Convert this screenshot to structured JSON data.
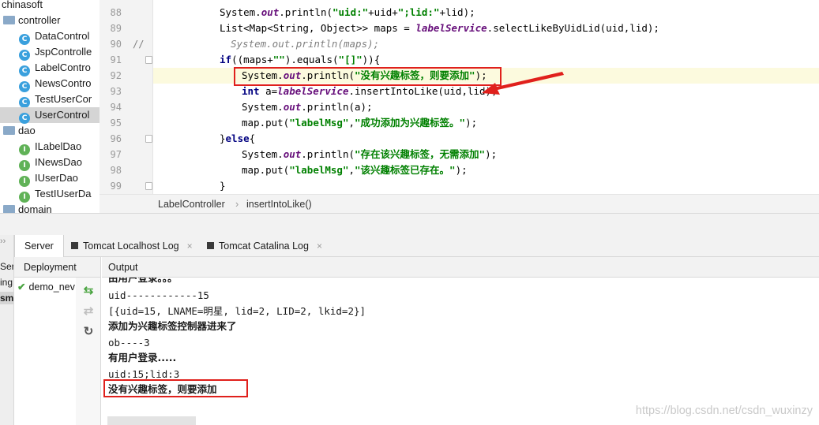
{
  "project_tree": {
    "root": "chinasoft",
    "folders": [
      "controller",
      "dao",
      "domain"
    ],
    "controller_items": [
      "DataControl",
      "JspControlle",
      "LabelContro",
      "NewsContro",
      "TestUserCor",
      "UserControl"
    ],
    "dao_items": [
      "ILabelDao",
      "INewsDao",
      "IUserDao",
      "TestIUserDa"
    ],
    "class_badge": "C",
    "interface_badge": "I"
  },
  "editor": {
    "line_numbers": [
      "88",
      "89",
      "90",
      "91",
      "92",
      "93",
      "94",
      "95",
      "96",
      "97",
      "98",
      "99"
    ],
    "comment_marker": "//",
    "lines": [
      [
        "",
        "",
        "",
        "System.",
        "out",
        ".println(",
        "\"uid:\"",
        "+uid+",
        "\";lid:\"",
        "+lid);"
      ],
      [
        "",
        "",
        "",
        "List<Map<String, Object>> maps = ",
        "labelService",
        ".selectLikeByUidLid(uid,lid);",
        "",
        "",
        "",
        ""
      ],
      [
        "",
        "",
        "",
        "",
        "",
        "",
        "",
        "",
        "",
        ""
      ]
    ],
    "code": {
      "l88_a": "System.",
      "l88_out": "out",
      "l88_b": ".println(",
      "l88_s1": "\"uid:\"",
      "l88_c": "+uid+",
      "l88_s2": "\";lid:\"",
      "l88_d": "+lid);",
      "l89_a": "List<Map<String, Object>> maps = ",
      "l89_svc": "labelService",
      "l89_b": ".selectLikeByUidLid(uid,lid);",
      "l90_cmt": "System.out.println(maps);",
      "l91_if": "if",
      "l91_a": "((maps+",
      "l91_s1": "\"\"",
      "l91_b": ").equals(",
      "l91_s2": "\"[]\"",
      "l91_c": ")){",
      "l92_a": "System.",
      "l92_out": "out",
      "l92_b": ".println(",
      "l92_s": "\"没有兴趣标签，则要添加\"",
      "l92_c": ");",
      "l93_int": "int",
      "l93_a": " a=",
      "l93_svc": "labelService",
      "l93_b": ".insertIntoLike(uid,lid);",
      "l94_a": "System.",
      "l94_out": "out",
      "l94_b": ".println(a);",
      "l95_a": "map.put(",
      "l95_s1": "\"labelMsg\"",
      "l95_b": ",",
      "l95_s2": "\"成功添加为兴趣标签。\"",
      "l95_c": ");",
      "l96_a": "}",
      "l96_else": "else",
      "l96_b": "{",
      "l97_a": "System.",
      "l97_out": "out",
      "l97_b": ".println(",
      "l97_s": "\"存在该兴趣标签，无需添加\"",
      "l97_c": ");",
      "l98_a": "map.put(",
      "l98_s1": "\"labelMsg\"",
      "l98_b": ",",
      "l98_s2": "\"该兴趣标签已存在。\"",
      "l98_c": ");",
      "l99_a": "}"
    }
  },
  "breadcrumb": {
    "class_name": "LabelController",
    "separator": "›",
    "method_name": "insertIntoLike()"
  },
  "bottom_panel": {
    "left_strip": [
      "Ser",
      "ing",
      "sm"
    ],
    "tabs": [
      {
        "label": "Server",
        "closable": false
      },
      {
        "label": "Tomcat Localhost Log",
        "closable": true
      },
      {
        "label": "Tomcat Catalina Log",
        "closable": true
      }
    ],
    "close_glyph": "×",
    "deployment_header": "Deployment",
    "deployment_item": "demo_nev",
    "output_header": "Output",
    "output_lines": [
      "由用户登录。。。",
      "uid------------15",
      "[{uid=15, LNAME=明星, lid=2, LID=2, lkid=2}]",
      "添加为兴趣标签控制器进来了",
      "ob----3",
      "有用户登录.....",
      "uid:15;lid:3",
      "没有兴趣标签，则要添加"
    ]
  },
  "watermark": "https://blog.csdn.net/csdn_wuxinzy",
  "colors": {
    "annotation_red": "#e0201c",
    "keyword": "#000080",
    "string": "#008000",
    "field": "#660e7a",
    "comment": "#808080",
    "selection": "#d5d5d5",
    "caret_line": "#fcfade"
  }
}
